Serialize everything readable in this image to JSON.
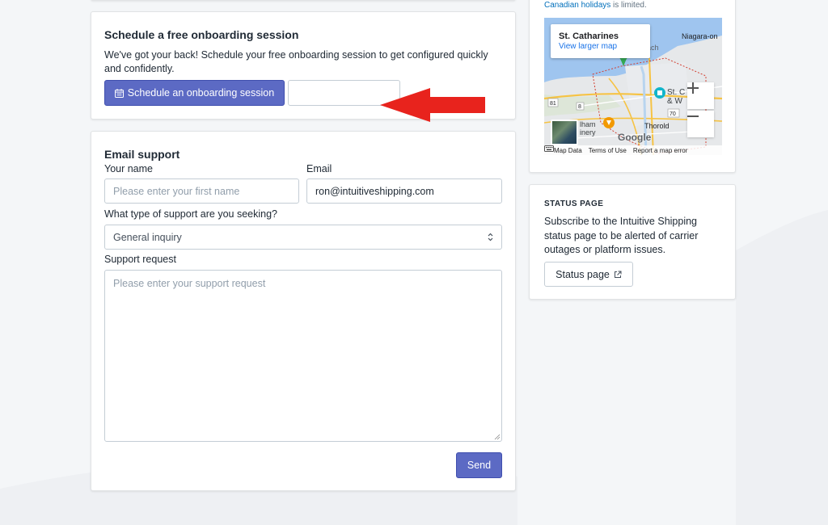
{
  "onboarding": {
    "title": "Schedule a free onboarding session",
    "description": "We've got your back! Schedule your free onboarding session to get configured quickly and confidently.",
    "schedule_button": "Schedule an onboarding session"
  },
  "email_support": {
    "title": "Email support",
    "name_label": "Your name",
    "name_placeholder": "Please enter your first name",
    "email_label": "Email",
    "email_value": "ron@intuitiveshipping.com",
    "type_label": "What type of support are you seeking?",
    "type_selected": "General inquiry",
    "request_label": "Support request",
    "request_placeholder": "Please enter your support request",
    "send_button": "Send"
  },
  "sidebar": {
    "holiday_link": "Canadian holidays",
    "holiday_suffix": " is limited.",
    "map": {
      "place": "St. Catharines",
      "larger_map_link": "View larger map",
      "labels": {
        "niagara": "Niagara-on",
        "beach": "each",
        "stc": "St. C",
        "welland": "& W",
        "thorold": "Thorold",
        "pelham": "lham",
        "inery": "inery",
        "r70": "70",
        "r81": "81",
        "r8": "8"
      },
      "google": "Google",
      "footer_map_data": "Map Data",
      "footer_terms": "Terms of Use",
      "footer_report": "Report a map error"
    },
    "status": {
      "heading": "STATUS PAGE",
      "description": "Subscribe to the Intuitive Shipping status page to be alerted of carrier outages or platform issues.",
      "button": "Status page"
    }
  },
  "colors": {
    "primary": "#5c6ac4",
    "annotation_arrow": "#e8231d",
    "link": "#006fbb"
  }
}
